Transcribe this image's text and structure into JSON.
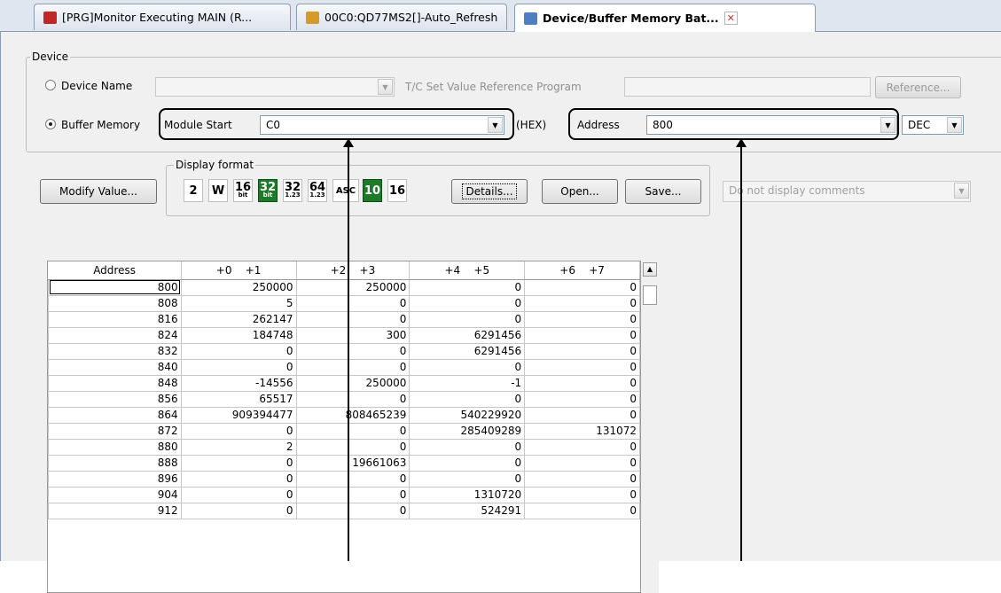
{
  "tabs": [
    {
      "label": "[PRG]Monitor Executing MAIN (R...",
      "icon": "program-icon"
    },
    {
      "label": "00C0:QD77MS2[]-Auto_Refresh",
      "icon": "module-icon"
    },
    {
      "label": "Device/Buffer Memory Bat...",
      "icon": "memory-icon",
      "active": true
    }
  ],
  "device_group": {
    "legend": "Device",
    "device_name_label": "Device Name",
    "device_name_value": "",
    "tc_label": "T/C Set Value Reference Program",
    "tc_value": "",
    "reference_button": "Reference...",
    "buffer_memory_label": "Buffer Memory",
    "module_start_label": "Module Start",
    "module_start_value": "C0",
    "hex_label": "(HEX)",
    "address_label": "Address",
    "address_value": "800",
    "radix_value": "DEC",
    "selected_radio": "buffer_memory"
  },
  "toolbar": {
    "modify_value": "Modify Value...",
    "display_format_legend": "Display format",
    "formats": [
      {
        "id": "fmt-2",
        "label": "2"
      },
      {
        "id": "fmt-w",
        "label": "W"
      },
      {
        "id": "fmt-16bit",
        "label": "16",
        "sub": "bit"
      },
      {
        "id": "fmt-32bit",
        "label": "32",
        "sub": "bit",
        "selected": true
      },
      {
        "id": "fmt-32real",
        "label": "32",
        "sub": "1.23"
      },
      {
        "id": "fmt-64real",
        "label": "64",
        "sub": "1.23"
      },
      {
        "id": "fmt-asc",
        "label": "ASC"
      },
      {
        "id": "fmt-10",
        "label": "10",
        "selected": true
      },
      {
        "id": "fmt-16",
        "label": "16"
      }
    ],
    "details": "Details...",
    "open": "Open...",
    "save": "Save...",
    "comment_option": "Do not display comments"
  },
  "table": {
    "headers": [
      "Address",
      "+0    +1",
      "+2    +3",
      "+4    +5",
      "+6    +7"
    ],
    "rows": [
      [
        "800",
        "250000",
        "250000",
        "0",
        "0"
      ],
      [
        "808",
        "5",
        "0",
        "0",
        "0"
      ],
      [
        "816",
        "262147",
        "0",
        "0",
        "0"
      ],
      [
        "824",
        "184748",
        "300",
        "6291456",
        "0"
      ],
      [
        "832",
        "0",
        "0",
        "6291456",
        "0"
      ],
      [
        "840",
        "0",
        "0",
        "0",
        "0"
      ],
      [
        "848",
        "-14556",
        "250000",
        "-1",
        "0"
      ],
      [
        "856",
        "65517",
        "0",
        "0",
        "0"
      ],
      [
        "864",
        "909394477",
        "808465239",
        "540229920",
        "0"
      ],
      [
        "872",
        "0",
        "0",
        "285409289",
        "131072"
      ],
      [
        "880",
        "2",
        "0",
        "0",
        "0"
      ],
      [
        "888",
        "0",
        "19661063",
        "0",
        "0"
      ],
      [
        "896",
        "0",
        "0",
        "0",
        "0"
      ],
      [
        "904",
        "0",
        "0",
        "1310720",
        "0"
      ],
      [
        "912",
        "0",
        "0",
        "524291",
        "0"
      ]
    ]
  },
  "colors": {
    "selected_format": "#1e7a29",
    "tab_strip": "#dfe6ef"
  }
}
